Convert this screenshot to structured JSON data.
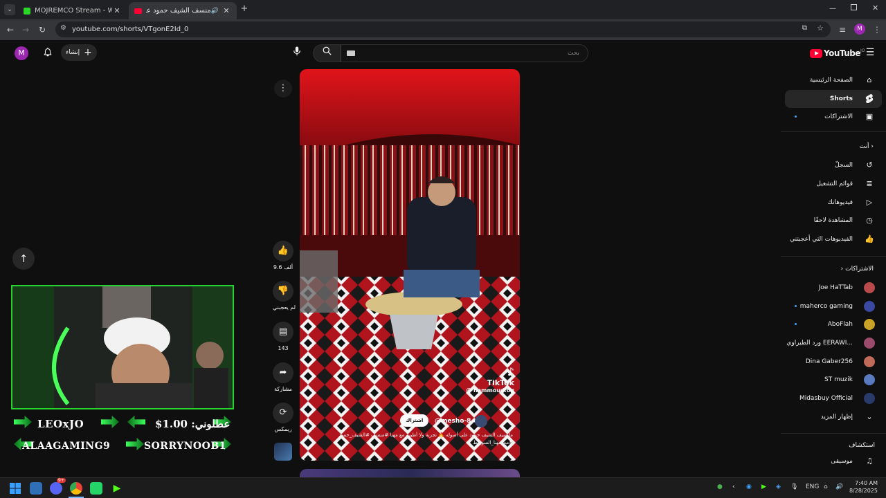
{
  "browser": {
    "tabs": [
      {
        "title": "MOJREMCO Stream - Watch Li",
        "active": false
      },
      {
        "title": "منسف الشيف حمود على أصـ",
        "active": true
      }
    ],
    "url": "youtube.com/shorts/VTgonE2Id_0"
  },
  "header": {
    "profile_initial": "M",
    "create_label": "إنشاء",
    "search_placeholder": "بحث",
    "logo_text": "YouTube",
    "logo_region": "JO"
  },
  "sidebar": {
    "main": [
      {
        "label": "الصفحة الرئيسية",
        "icon": "home-icon"
      },
      {
        "label": "Shorts",
        "icon": "shorts-icon",
        "active": true
      },
      {
        "label": "الاشتراكات",
        "icon": "subscriptions-icon"
      }
    ],
    "you_heading": "أنت",
    "you": [
      {
        "label": "السجلّ",
        "icon": "history-icon"
      },
      {
        "label": "قوائم التشغيل",
        "icon": "playlists-icon"
      },
      {
        "label": "فيديوهاتك",
        "icon": "your-videos-icon"
      },
      {
        "label": "المشاهدة لاحقًا",
        "icon": "watch-later-icon"
      },
      {
        "label": "الفيديوهات التي أعجبتني",
        "icon": "liked-icon"
      }
    ],
    "subs_heading": "الاشتراكات",
    "subscriptions": [
      {
        "label": "Joe HaTTab",
        "color": "#b84a4a",
        "dot": false
      },
      {
        "label": "maherco gaming",
        "color": "#3a4aa0",
        "dot": true
      },
      {
        "label": "AboFlah",
        "color": "#c9a227",
        "dot": true
      },
      {
        "label": "ورد الطيراوي EERAWI...",
        "color": "#9a4a6a",
        "dot": false
      },
      {
        "label": "Dina Gaber256",
        "color": "#c06a5a",
        "dot": false
      },
      {
        "label": "ST muzik",
        "color": "#5a7ac0",
        "dot": false
      },
      {
        "label": "Midasbuy Official",
        "color": "#2a3a6a",
        "dot": false
      }
    ],
    "show_more": "إظهار المزيد",
    "explore_heading": "استكشاف",
    "explore": [
      {
        "label": "موسيقى",
        "icon": "music-icon"
      }
    ]
  },
  "video": {
    "watermark_brand": "TikTok",
    "watermark_user": "@ hammoud.og",
    "channel_handle": "@mesho-8",
    "subscribe_label": "اشتراك",
    "caption_line1": "مايسيف الشيف حمود على أصوله 🔥 تجربة ولا أطيب مع مهنا #منسف #الشيف_حمود",
    "caption_line2": "#مع_مهنا_السويقط"
  },
  "actions": {
    "likes": "9.6 ألف",
    "dislike_label": "لم يعجبني",
    "comments": "143",
    "share_label": "مشاركة",
    "remix_label": "ريمكس"
  },
  "stream_overlay": {
    "donors": [
      {
        "name": "LEOxJO",
        "side": "left"
      },
      {
        "name": "عطلوني: 1.00$",
        "side": "right"
      },
      {
        "name": "ALAAGAMING9",
        "side": "left"
      },
      {
        "name": "SORRYNOOB1",
        "side": "right"
      }
    ]
  },
  "taskbar": {
    "language": "ENG",
    "time": "7:40 AM",
    "date": "8/28/2025",
    "discord_badge": "9+"
  }
}
